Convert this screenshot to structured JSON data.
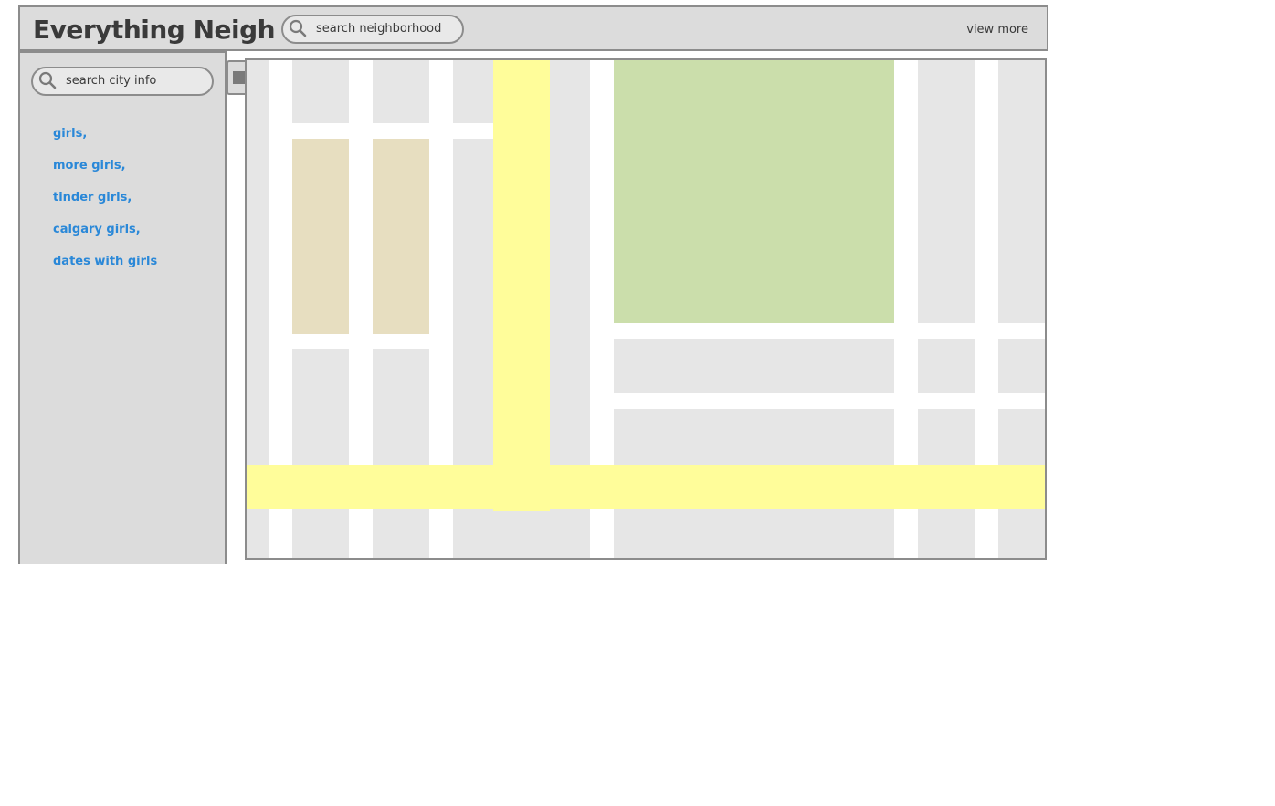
{
  "header": {
    "title": "Everything Neigh",
    "search_placeholder": "search neighborhood",
    "view_more": "view more"
  },
  "sidebar": {
    "search_placeholder": "search city info",
    "links": [
      {
        "label": "girls,"
      },
      {
        "label": "more girls,"
      },
      {
        "label": "tinder girls,"
      },
      {
        "label": "calgary girls,"
      },
      {
        "label": "dates with girls"
      }
    ]
  },
  "map": {
    "colors": {
      "block": "#e6e6e6",
      "building": "#e7dec0",
      "park": "#cbdeab",
      "road": "#fffd9a"
    }
  },
  "icons": {
    "search": "search-icon",
    "toggle": "arrow-right-icon"
  }
}
